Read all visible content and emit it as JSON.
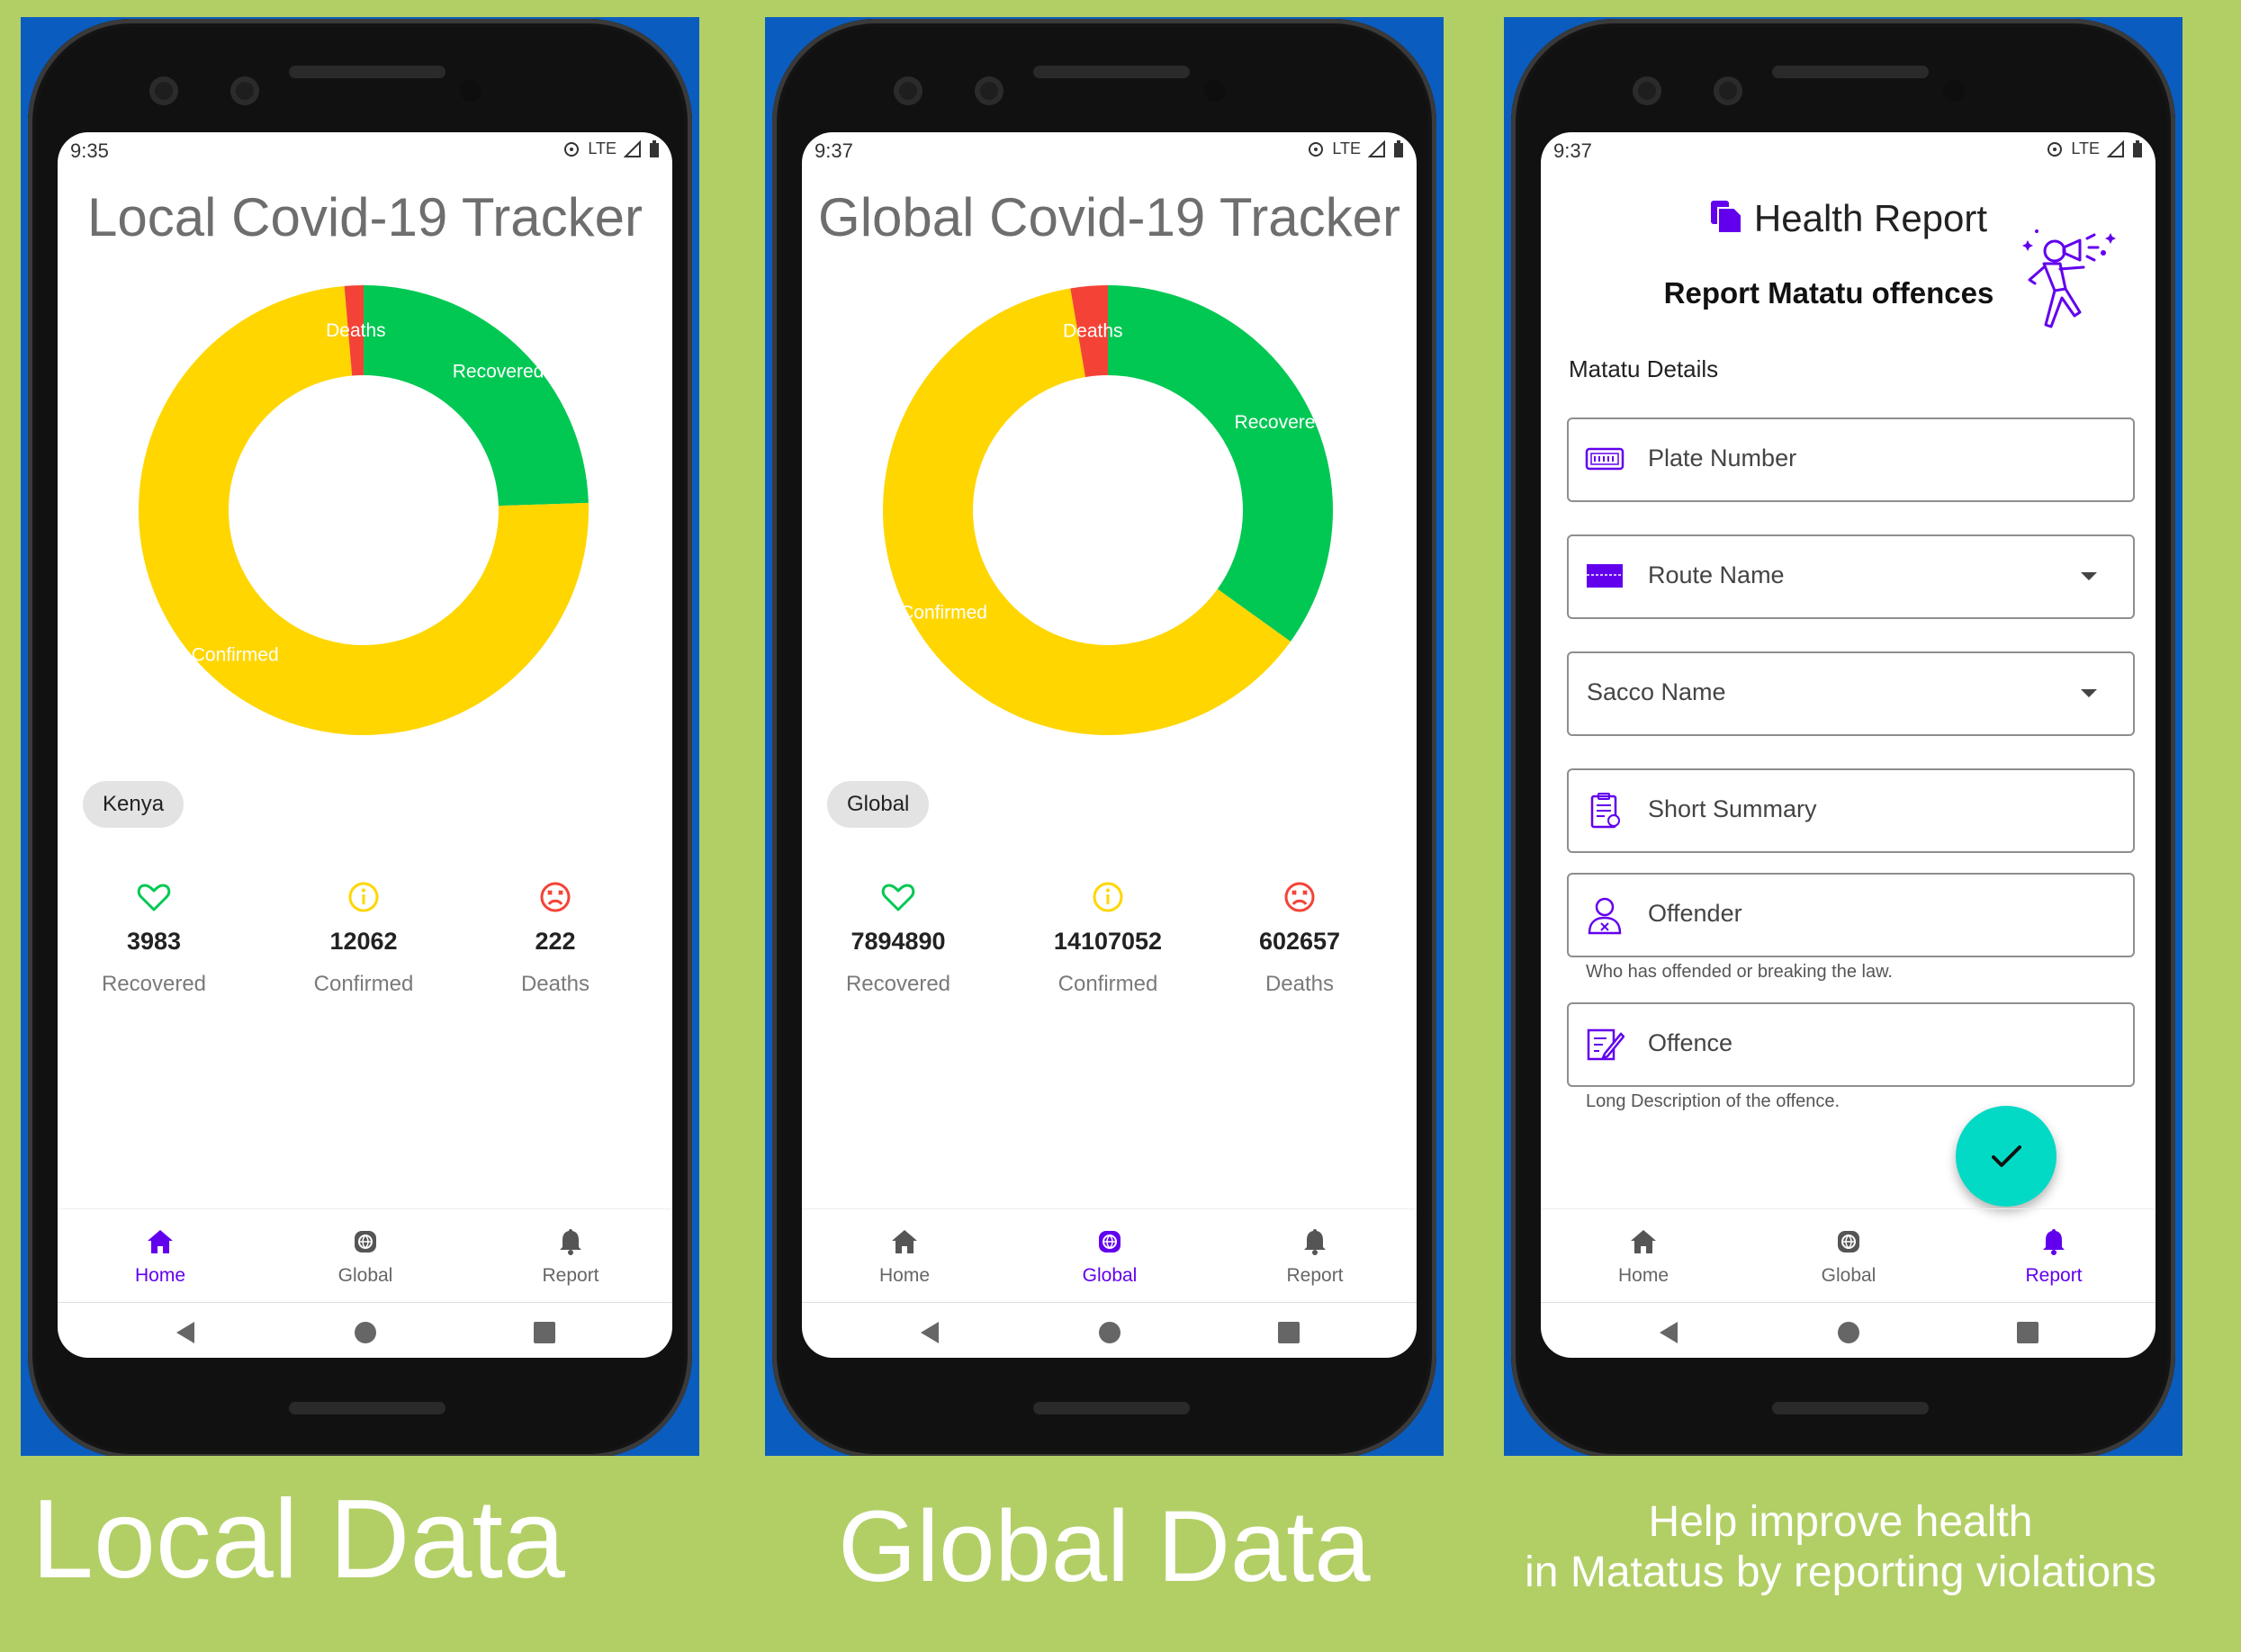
{
  "colors": {
    "background": "#b2cf66",
    "primary": "#6200ee",
    "recovered": "#00c853",
    "confirmed": "#ffd600",
    "deaths": "#f44336",
    "fab": "#03dac5"
  },
  "panels": [
    {
      "status_time": "9:35",
      "status_network": "LTE",
      "title": "Local Covid-19 Tracker",
      "chip": "Kenya",
      "chart_data": {
        "type": "pie",
        "labels": [
          "Deaths",
          "Recovered",
          "Confirmed"
        ],
        "values": [
          222,
          3983,
          12062
        ],
        "colors": [
          "#f44336",
          "#00c853",
          "#ffd600"
        ]
      },
      "stats": [
        {
          "icon": "heart-icon",
          "value": "3983",
          "label": "Recovered"
        },
        {
          "icon": "info-icon",
          "value": "12062",
          "label": "Confirmed"
        },
        {
          "icon": "sad-face-icon",
          "value": "222",
          "label": "Deaths"
        }
      ],
      "nav": [
        {
          "label": "Home",
          "icon": "home-icon",
          "active": true
        },
        {
          "label": "Global",
          "icon": "globe-icon",
          "active": false
        },
        {
          "label": "Report",
          "icon": "bell-icon",
          "active": false
        }
      ],
      "caption": "Local Data"
    },
    {
      "status_time": "9:37",
      "status_network": "LTE",
      "title": "Global Covid-19 Tracker",
      "chip": "Global",
      "chart_data": {
        "type": "pie",
        "labels": [
          "Deaths",
          "Recovered",
          "Confirmed"
        ],
        "values": [
          602657,
          7894890,
          14107052
        ],
        "colors": [
          "#f44336",
          "#00c853",
          "#ffd600"
        ]
      },
      "stats": [
        {
          "icon": "heart-icon",
          "value": "7894890",
          "label": "Recovered"
        },
        {
          "icon": "info-icon",
          "value": "14107052",
          "label": "Confirmed"
        },
        {
          "icon": "sad-face-icon",
          "value": "602657",
          "label": "Deaths"
        }
      ],
      "nav": [
        {
          "label": "Home",
          "icon": "home-icon",
          "active": false
        },
        {
          "label": "Global",
          "icon": "globe-icon",
          "active": true
        },
        {
          "label": "Report",
          "icon": "bell-icon",
          "active": false
        }
      ],
      "caption": "Global Data"
    },
    {
      "status_time": "9:37",
      "status_network": "LTE",
      "report": {
        "title": "Health Report",
        "subtitle": "Report Matatu offences",
        "section": "Matatu Details",
        "fields": [
          {
            "label": "Plate Number",
            "icon": "license-plate-icon",
            "dropdown": false
          },
          {
            "label": "Route Name",
            "icon": "route-card-icon",
            "dropdown": true
          },
          {
            "label": "Sacco Name",
            "icon": "",
            "dropdown": true
          },
          {
            "label": "Short Summary",
            "icon": "clipboard-icon",
            "dropdown": false
          },
          {
            "label": "Offender",
            "icon": "person-icon",
            "dropdown": false
          },
          {
            "label": "Offence",
            "icon": "edit-note-icon",
            "dropdown": false
          }
        ],
        "offender_helper": "Who has offended or breaking the law.",
        "offence_helper": "Long Description of the offence."
      },
      "nav": [
        {
          "label": "Home",
          "icon": "home-icon",
          "active": false
        },
        {
          "label": "Global",
          "icon": "globe-icon",
          "active": false
        },
        {
          "label": "Report",
          "icon": "bell-icon",
          "active": true
        }
      ],
      "caption_line1": "Help improve health",
      "caption_line2": "in Matatus by reporting violations"
    }
  ]
}
